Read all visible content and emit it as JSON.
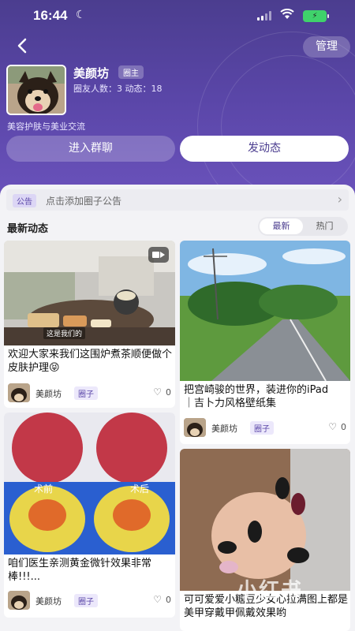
{
  "status": {
    "time": "16:44"
  },
  "header": {
    "back_label": "‹",
    "manage_label": "管理"
  },
  "group": {
    "name": "美颜坊",
    "owner_badge": "圈主",
    "stats": "圈友人数：3   动态：18",
    "description": "美容护肤与美业交流"
  },
  "actions": {
    "join_chat": "进入群聊",
    "post": "发动态"
  },
  "notice": {
    "tag": "公告",
    "text": "点击添加圈子公告",
    "chevron": "›"
  },
  "feed": {
    "title": "最新动态",
    "sort_options": [
      "最新",
      "热门"
    ],
    "active_sort": "最新",
    "cards": [
      {
        "title": "欢迎大家来我们这围炉煮茶顺便做个皮肤护理😝",
        "author": "美颜坊",
        "tag": "圈子",
        "likes": "0",
        "image_caption": "这是我们的",
        "has_video": true
      },
      {
        "title": "把宫崎骏的世界，装进你的iPad｜吉卜力风格壁纸集",
        "author": "美颜坊",
        "tag": "圈子",
        "likes": "0"
      },
      {
        "title": "咱们医生亲测黄金微针效果非常棒!!!...",
        "author": "美颜坊",
        "tag": "圈子",
        "likes": "0",
        "image_labels": [
          "术前",
          "术后"
        ]
      },
      {
        "title": "可可爱爱小糖豆少女心拉满图上都是美甲穿戴甲佩戴效果哟",
        "author": "美颜坊",
        "tag": "圈子",
        "likes": "0"
      }
    ]
  },
  "watermark": "小红书",
  "icons": {
    "like": "heart-outline-icon",
    "video": "video-camera-icon",
    "back": "chevron-left-icon",
    "notice_arrow": "chevron-right-icon"
  },
  "colors": {
    "brand": "#5a46a8",
    "hero_top": "#4b3d8f",
    "battery": "#3fd26b"
  }
}
